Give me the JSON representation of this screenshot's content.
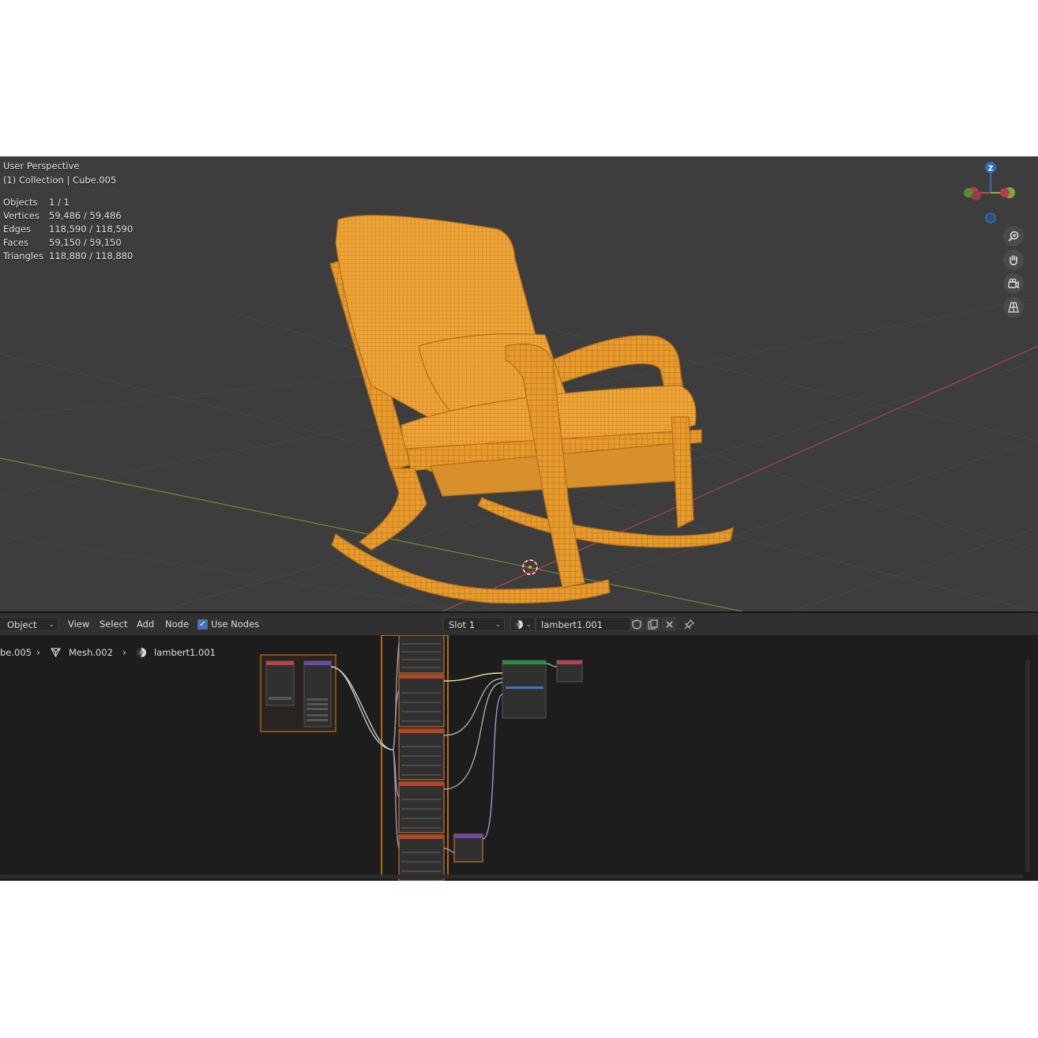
{
  "viewport": {
    "title": "User Perspective",
    "collection": "(1) Collection | Cube.005",
    "stats": [
      {
        "label": "Objects",
        "value": "1 / 1"
      },
      {
        "label": "Vertices",
        "value": "59,486 / 59,486"
      },
      {
        "label": "Edges",
        "value": "118,590 / 118,590"
      },
      {
        "label": "Faces",
        "value": "59,150 / 59,150"
      },
      {
        "label": "Triangles",
        "value": "118,880 / 118,880"
      }
    ],
    "gizmo_axis_z": "Z",
    "colors": {
      "selection": "#f0a030",
      "background": "#3d3d3d",
      "x_axis": "#c0485a",
      "y_axis": "#7a9e3c"
    }
  },
  "node_header": {
    "mode": "Object",
    "menus": [
      "View",
      "Select",
      "Add",
      "Node"
    ],
    "use_nodes_label": "Use Nodes",
    "use_nodes_checked": true,
    "slot": "Slot 1",
    "material": "lambert1.001"
  },
  "breadcrumb": {
    "object": "be.005",
    "mesh": "Mesh.002",
    "material": "lambert1.001"
  },
  "icons": [
    "zoom-icon",
    "hand-pan-icon",
    "camera-icon",
    "perspective-grid-icon",
    "mesh-icon",
    "material-icon",
    "shield-icon",
    "copy-icon",
    "close-icon",
    "pin-icon",
    "chevron-right-icon"
  ]
}
